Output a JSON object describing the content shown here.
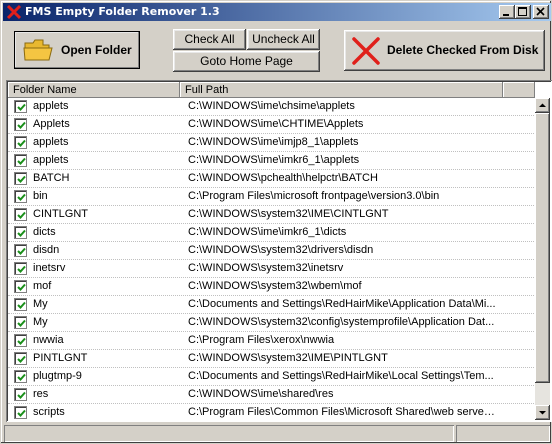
{
  "window": {
    "title": "FMS Empty Folder Remover 1.3",
    "controls": {
      "minimize": "minimize-icon",
      "maximize": "maximize-icon",
      "close": "close-icon"
    }
  },
  "toolbar": {
    "open_folder_label": "Open Folder",
    "check_all_label": "Check All",
    "uncheck_all_label": "Uncheck All",
    "home_page_label": "Goto Home Page",
    "delete_label": "Delete Checked From Disk"
  },
  "list": {
    "columns": [
      "Folder Name",
      "Full Path"
    ],
    "rows": [
      {
        "checked": true,
        "name": "applets",
        "path": "C:\\WINDOWS\\ime\\chsime\\applets"
      },
      {
        "checked": true,
        "name": "Applets",
        "path": "C:\\WINDOWS\\ime\\CHTIME\\Applets"
      },
      {
        "checked": true,
        "name": "applets",
        "path": "C:\\WINDOWS\\ime\\imjp8_1\\applets"
      },
      {
        "checked": true,
        "name": "applets",
        "path": "C:\\WINDOWS\\ime\\imkr6_1\\applets"
      },
      {
        "checked": true,
        "name": "BATCH",
        "path": "C:\\WINDOWS\\pchealth\\helpctr\\BATCH"
      },
      {
        "checked": true,
        "name": "bin",
        "path": "C:\\Program Files\\microsoft frontpage\\version3.0\\bin"
      },
      {
        "checked": true,
        "name": "CINTLGNT",
        "path": "C:\\WINDOWS\\system32\\IME\\CINTLGNT"
      },
      {
        "checked": true,
        "name": "dicts",
        "path": "C:\\WINDOWS\\ime\\imkr6_1\\dicts"
      },
      {
        "checked": true,
        "name": "disdn",
        "path": "C:\\WINDOWS\\system32\\drivers\\disdn"
      },
      {
        "checked": true,
        "name": "inetsrv",
        "path": "C:\\WINDOWS\\system32\\inetsrv"
      },
      {
        "checked": true,
        "name": "mof",
        "path": "C:\\WINDOWS\\system32\\wbem\\mof"
      },
      {
        "checked": true,
        "name": "My",
        "path": "C:\\Documents and Settings\\RedHairMike\\Application Data\\Mi..."
      },
      {
        "checked": true,
        "name": "My",
        "path": "C:\\WINDOWS\\system32\\config\\systemprofile\\Application Dat..."
      },
      {
        "checked": true,
        "name": "nwwia",
        "path": "C:\\Program Files\\xerox\\nwwia"
      },
      {
        "checked": true,
        "name": "PINTLGNT",
        "path": "C:\\WINDOWS\\system32\\IME\\PINTLGNT"
      },
      {
        "checked": true,
        "name": "plugtmp-9",
        "path": "C:\\Documents and Settings\\RedHairMike\\Local Settings\\Tem..."
      },
      {
        "checked": true,
        "name": "res",
        "path": "C:\\WINDOWS\\ime\\shared\\res"
      },
      {
        "checked": true,
        "name": "scripts",
        "path": "C:\\Program Files\\Common Files\\Microsoft Shared\\web server ..."
      }
    ]
  },
  "colors": {
    "title_gradient_start": "#0a246a",
    "title_gradient_end": "#a6caf0",
    "delete_x": "#e0201a",
    "folder_yellow": "#f4c542",
    "check_green": "#1a8f1a"
  }
}
